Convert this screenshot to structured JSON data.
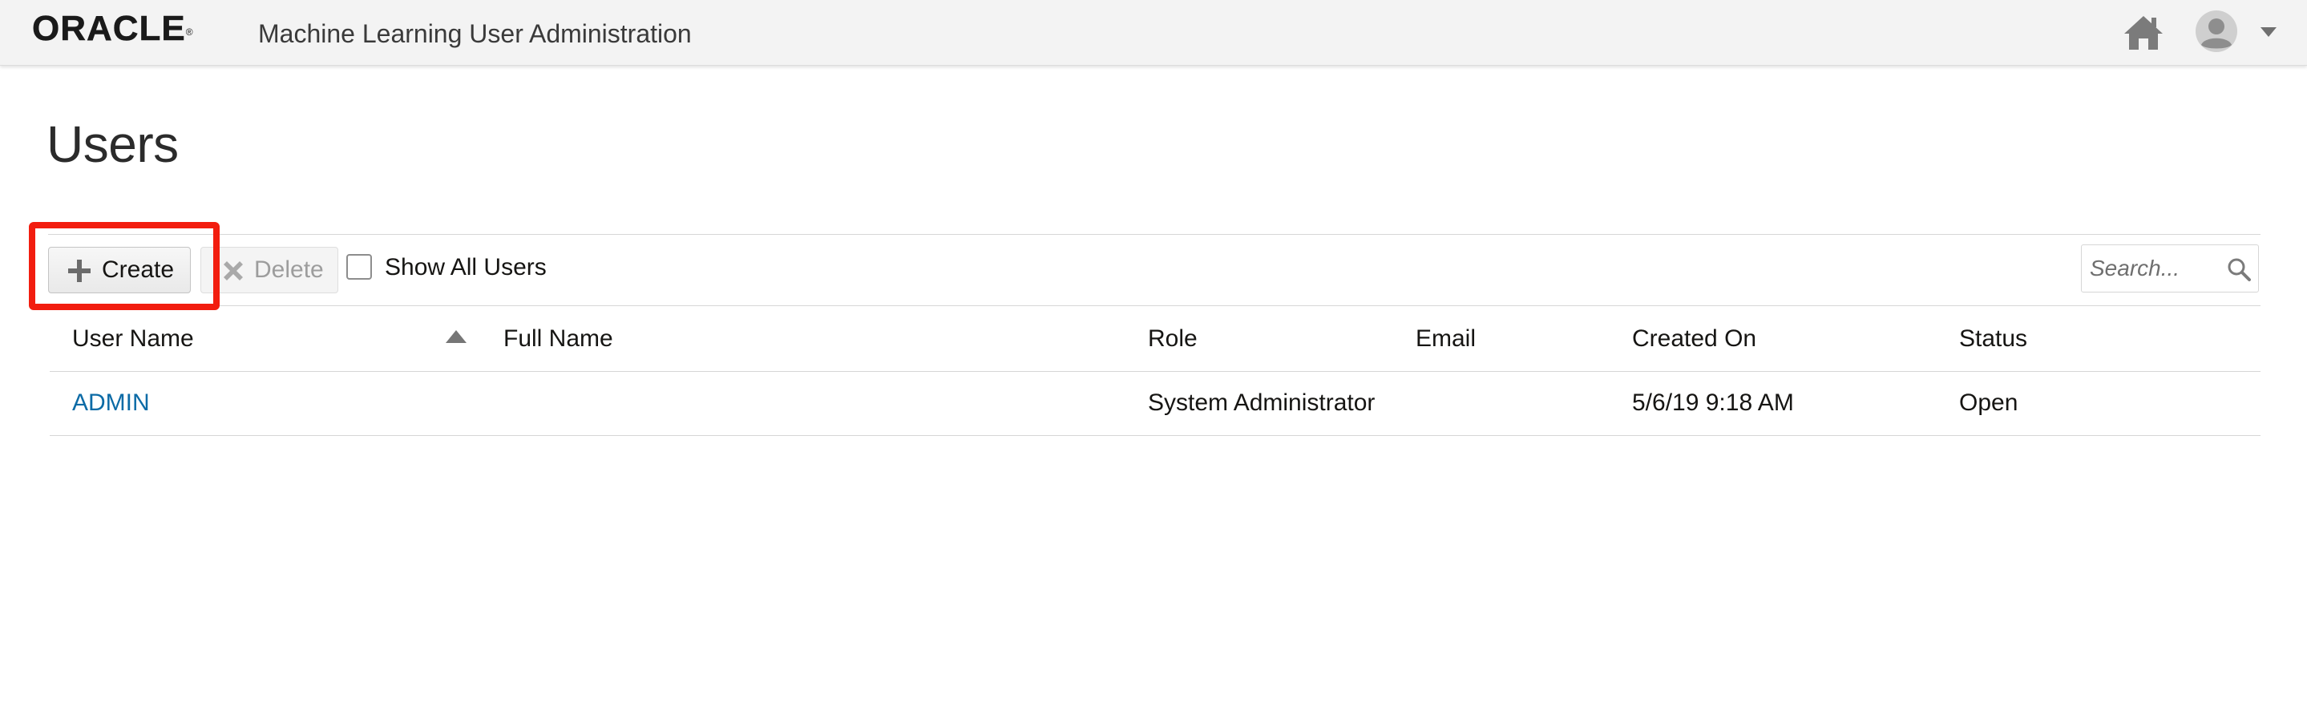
{
  "header": {
    "logo_text": "ORACLE",
    "logo_mark": "®",
    "app_title": "Machine Learning User Administration",
    "home_icon": "home-icon",
    "user_icon": "user-avatar-icon"
  },
  "page": {
    "title": "Users"
  },
  "toolbar": {
    "create_label": "Create",
    "create_icon": "plus-icon",
    "delete_label": "Delete",
    "delete_icon": "x-icon",
    "delete_disabled": true,
    "show_all_label": "Show All Users",
    "show_all_checked": false,
    "search_placeholder": "Search...",
    "search_icon": "search-icon",
    "highlight_color": "#f21d0f"
  },
  "table": {
    "columns": {
      "user_name": "User Name",
      "full_name": "Full Name",
      "role": "Role",
      "email": "Email",
      "created_on": "Created On",
      "status": "Status"
    },
    "sort": {
      "column": "User Name",
      "direction": "ascending"
    },
    "rows": [
      {
        "user_name": "ADMIN",
        "full_name": "",
        "role": "System Administrator",
        "email": "",
        "created_on": "5/6/19 9:18 AM",
        "status": "Open"
      }
    ]
  },
  "colors": {
    "link": "#0c6ba6",
    "header_bg": "#f3f3f3"
  }
}
